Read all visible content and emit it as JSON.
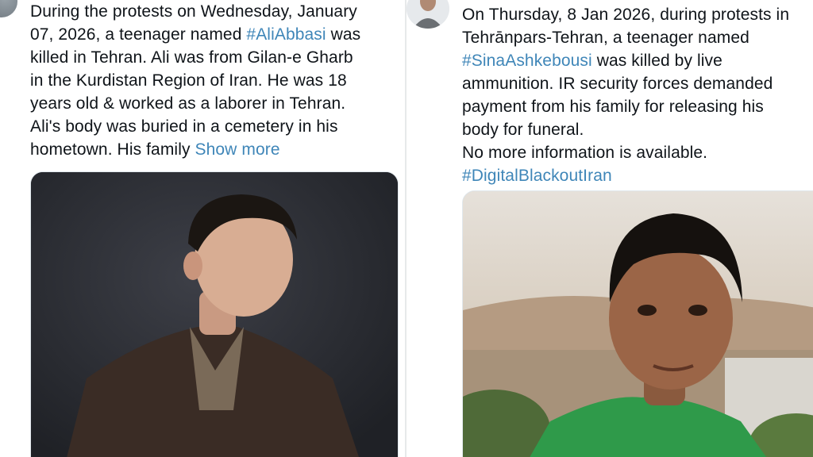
{
  "left_tweet": {
    "text_lines": [
      "During the protests on Wednesday, January",
      "07, 2026, a teenager named ",
      "#AliAbbasi",
      " was",
      "killed in Tehran. Ali was from Gilan-e Gharb",
      "in the Kurdistan Region of Iran. He was 18",
      "years old & worked as a laborer in Tehran.",
      "Ali's body was buried in a cemetery in his",
      "hometown. His family ",
      "Show more"
    ],
    "image_alt": "photo-of-young-man-looking-up"
  },
  "right_tweet": {
    "text_lines": [
      "On Thursday, 8 Jan 2026, during protests in",
      "Tehrānpars-Tehran, a teenager named",
      "#SinaAshkebousi",
      " was killed by live",
      "ammunition. IR security forces demanded",
      "payment from his family for releasing his",
      "body for funeral.",
      "No more information is available.",
      "#DigitalBlackoutIran"
    ],
    "image_alt": "photo-of-teenage-boy-in-green-shirt"
  },
  "colors": {
    "text": "#0f1419",
    "link": "#3f86b8",
    "border": "#e7e9ea"
  }
}
